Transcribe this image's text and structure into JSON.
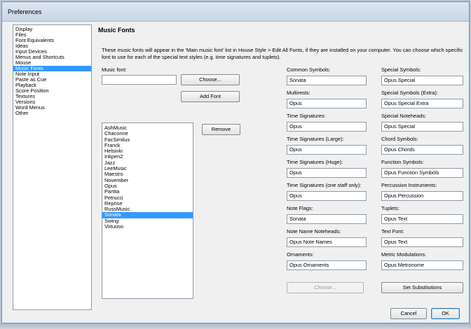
{
  "window": {
    "title": "Preferences"
  },
  "sidebar": {
    "items": [
      {
        "label": "Display",
        "selected": false
      },
      {
        "label": "Files",
        "selected": false
      },
      {
        "label": "Font Equivalents",
        "selected": false
      },
      {
        "label": "Ideas",
        "selected": false
      },
      {
        "label": "Input Devices",
        "selected": false
      },
      {
        "label": "Menus and Shortcuts",
        "selected": false
      },
      {
        "label": "Mouse",
        "selected": false
      },
      {
        "label": "Music Fonts",
        "selected": true
      },
      {
        "label": "Note Input",
        "selected": false
      },
      {
        "label": "Paste as Cue",
        "selected": false
      },
      {
        "label": "Playback",
        "selected": false
      },
      {
        "label": "Score Position",
        "selected": false
      },
      {
        "label": "Textures",
        "selected": false
      },
      {
        "label": "Versions",
        "selected": false
      },
      {
        "label": "Word Menus",
        "selected": false
      },
      {
        "label": "Other",
        "selected": false
      }
    ]
  },
  "page": {
    "heading": "Music Fonts",
    "description": "These music fonts will appear in the 'Main music font' list in House Style > Edit All Fonts, if they are installed on your computer.  You can choose which specific font to use for each of the special text styles (e.g. time signatures and tuplets)."
  },
  "music_font": {
    "label": "Music font:",
    "value": "",
    "choose_label": "Choose...",
    "add_font_label": "Add Font",
    "remove_label": "Remove",
    "fonts": [
      {
        "name": "AshMusic",
        "selected": false
      },
      {
        "name": "Chaconne",
        "selected": false
      },
      {
        "name": "FacSimilus",
        "selected": false
      },
      {
        "name": "Franck",
        "selected": false
      },
      {
        "name": "Helsinki",
        "selected": false
      },
      {
        "name": "Inkpen2",
        "selected": false
      },
      {
        "name": "Jazz",
        "selected": false
      },
      {
        "name": "LeeMusic",
        "selected": false
      },
      {
        "name": "Maestro",
        "selected": false
      },
      {
        "name": "November",
        "selected": false
      },
      {
        "name": "Opus",
        "selected": false
      },
      {
        "name": "Partita",
        "selected": false
      },
      {
        "name": "Petrucci",
        "selected": false
      },
      {
        "name": "Reprise",
        "selected": false
      },
      {
        "name": "RussMusic",
        "selected": false
      },
      {
        "name": "Sonata",
        "selected": true
      },
      {
        "name": "Swing",
        "selected": false
      },
      {
        "name": "Virtuoso",
        "selected": false
      }
    ]
  },
  "styles_left": [
    {
      "label": "Common Symbols:",
      "value": "Sonata"
    },
    {
      "label": "Multirests:",
      "value": "Opus"
    },
    {
      "label": "Time Signatures:",
      "value": "Opus"
    },
    {
      "label": "Time Signatures (Large):",
      "value": "Opus"
    },
    {
      "label": "Time Signatures (Huge):",
      "value": "Opus"
    },
    {
      "label": "Time Signatures (one staff only):",
      "value": "Opus"
    },
    {
      "label": "Note Flags:",
      "value": "Sonata"
    },
    {
      "label": "Note Name Noteheads:",
      "value": "Opus Note Names"
    },
    {
      "label": "Ornaments:",
      "value": "Opus Ornaments"
    }
  ],
  "styles_right": [
    {
      "label": "Special Symbols:",
      "value": "Opus Special"
    },
    {
      "label": "Special Symbols (Extra):",
      "value": "Opus Special Extra"
    },
    {
      "label": "Special Noteheads:",
      "value": "Opus Special"
    },
    {
      "label": "Chord Symbols:",
      "value": "Opus Chords"
    },
    {
      "label": "Function Symbols:",
      "value": "Opus Function Symbols"
    },
    {
      "label": "Percussion Instruments:",
      "value": "Opus Percussion"
    },
    {
      "label": "Tuplets:",
      "value": "Opus Text"
    },
    {
      "label": "Text Font:",
      "value": "Opus Text"
    },
    {
      "label": "Metric Modulations:",
      "value": "Opus Metronome"
    }
  ],
  "actions": {
    "choose_label": "Choose...",
    "set_substitutions_label": "Set Substitutions",
    "cancel_label": "Cancel",
    "ok_label": "OK"
  }
}
